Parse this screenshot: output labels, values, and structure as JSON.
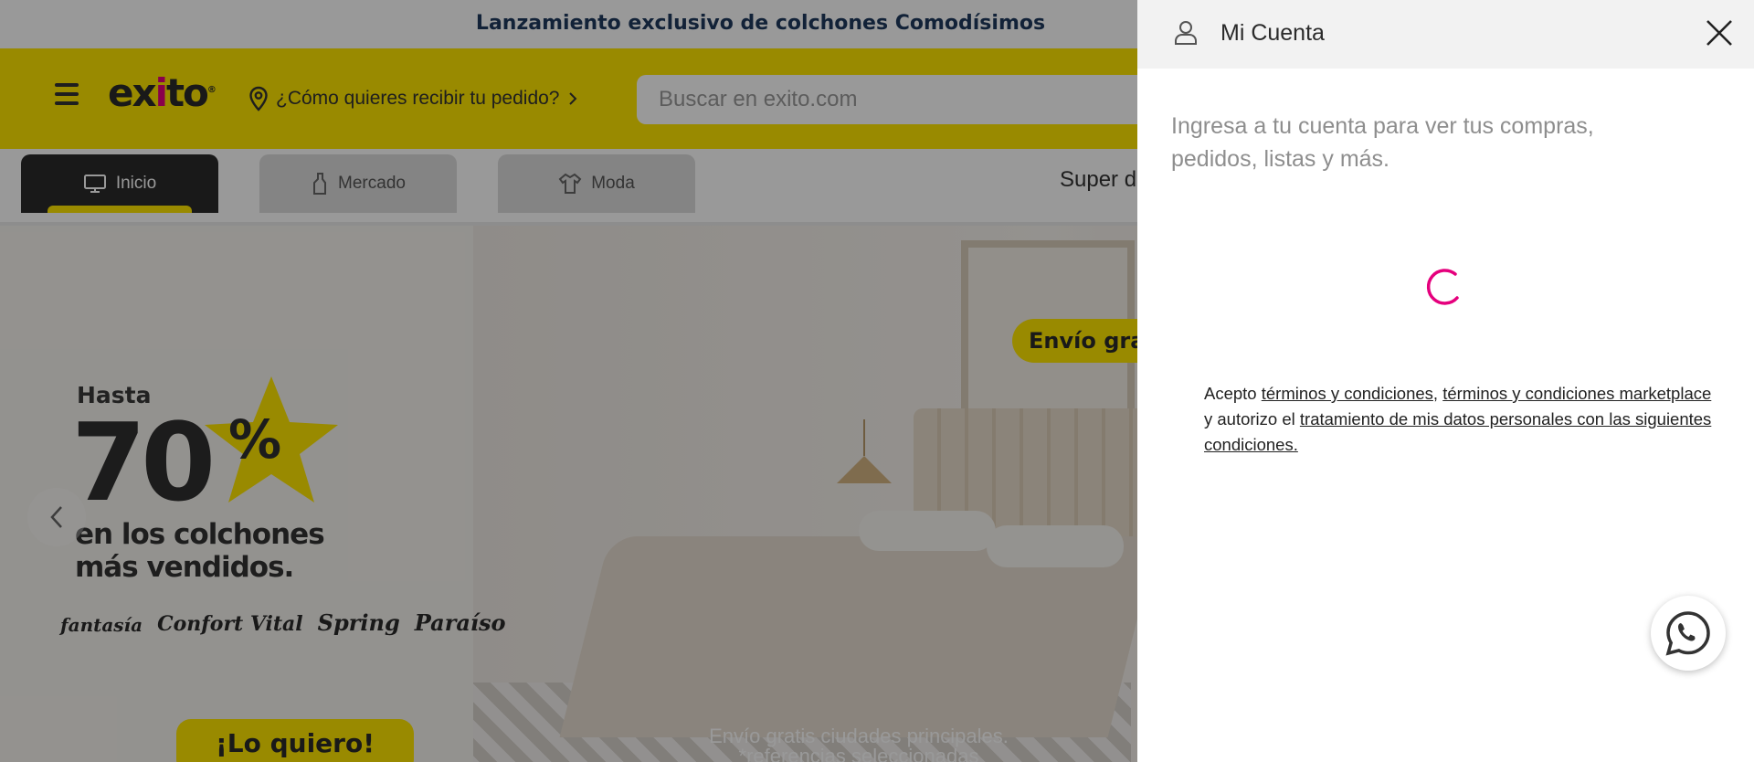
{
  "announcement": {
    "text": "Lanzamiento exclusivo de colchones Comodísimos"
  },
  "header": {
    "logo_prefix": "ex",
    "logo_dot": "i",
    "logo_suffix": "to",
    "logo_reg": "®",
    "delivery_prompt": "¿Cómo quieres recibir tu pedido?",
    "search_placeholder": "Buscar en exito.com"
  },
  "tabs": [
    {
      "label": "Inicio",
      "icon": "monitor-icon",
      "active": true
    },
    {
      "label": "Mercado",
      "icon": "bottle-icon",
      "active": false
    },
    {
      "label": "Moda",
      "icon": "shirt-icon",
      "active": false
    }
  ],
  "tabs_overflow_label": "Super d",
  "hero": {
    "hasta": "Hasta",
    "big_number": "70",
    "percent": "%",
    "copy_line1": "en los colchones",
    "copy_line2": "más vendidos.",
    "brands": [
      "fantasía",
      "Confort Vital",
      "Spring",
      "Paraíso"
    ],
    "cta": "¡Lo quiero!",
    "shipping_pill": "Envío gratis",
    "caption_line1": "Envío gratis ciudades principales.",
    "caption_line2": "*referencias seleccionadas"
  },
  "drawer": {
    "title": "Mi Cuenta",
    "message": "Ingresa a tu cuenta para ver tus compras, pedidos, listas y más.",
    "terms_prefix": "Acepto ",
    "terms_link1": "términos y condiciones",
    "terms_sep": ", ",
    "terms_link2": "términos y condiciones marketplace",
    "terms_mid": " y autorizo el ",
    "terms_link3": "tratamiento de mis datos personales con las siguientes condiciones."
  },
  "colors": {
    "brand_yellow": "#ffe600",
    "spinner_pink": "#e5007d",
    "announcement_text": "#1f3a5e"
  }
}
